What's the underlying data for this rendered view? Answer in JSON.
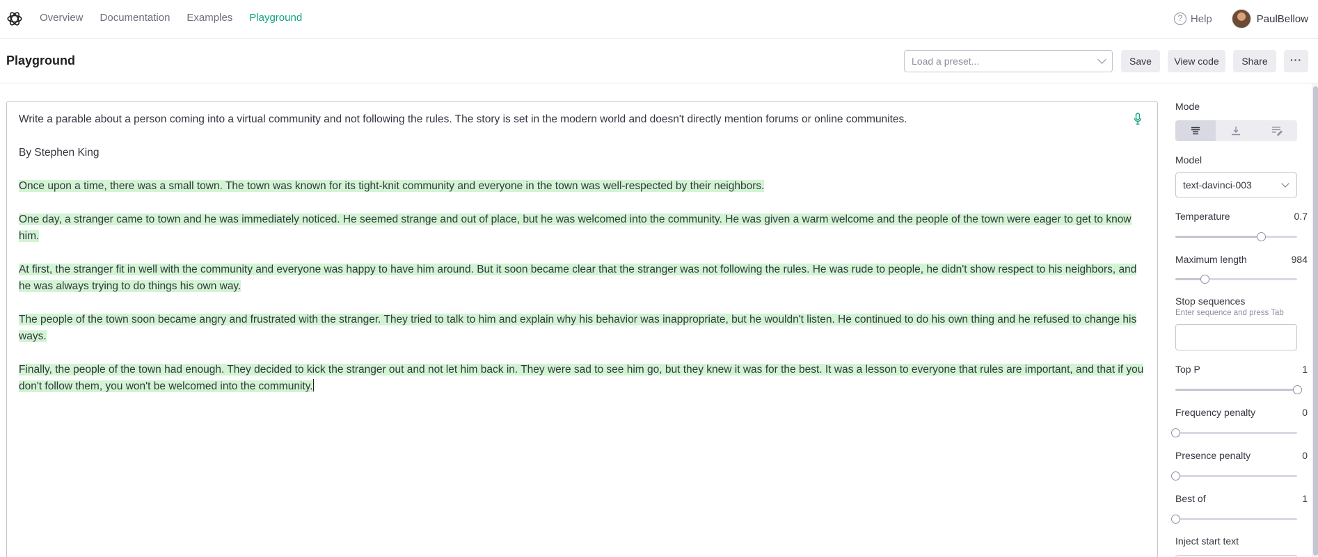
{
  "nav": {
    "links": [
      {
        "label": "Overview"
      },
      {
        "label": "Documentation"
      },
      {
        "label": "Examples"
      },
      {
        "label": "Playground"
      }
    ],
    "active_link": "Playground",
    "help_label": "Help",
    "username": "PaulBellow",
    "accent_color": "#10a37f"
  },
  "header": {
    "title": "Playground",
    "preset_placeholder": "Load a preset...",
    "save_label": "Save",
    "view_code_label": "View code",
    "share_label": "Share",
    "more_label": "···"
  },
  "editor": {
    "prompt": "Write a parable about a person coming into a virtual community and not following the rules. The story is set in the modern world and doesn't directly mention forums or online communites.",
    "byline": "By Stephen King",
    "completion_paragraphs": [
      "Once upon a time, there was a small town. The town was known for its tight-knit community and everyone in the town was well-respected by their neighbors.",
      "One day, a stranger came to town and he was immediately noticed. He seemed strange and out of place, but he was welcomed into the community. He was given a warm welcome and the people of the town were eager  to get to know him.",
      "At first, the stranger fit in well with the community and everyone was happy to have him around. But it soon became clear that the stranger was not following the rules. He was rude to people, he didn't show respect to his neighbors, and he was always trying to do things his own way.",
      "The people of the town soon became angry and frustrated with the stranger. They tried to talk to him and explain why his behavior was inappropriate, but he wouldn't listen. He continued to do his own thing and he refused to change his ways.",
      "Finally, the people of the town had enough. They decided to kick the stranger out and not let him back in. They were sad to see him go, but they knew it was for the best. It was a lesson to everyone that rules are important, and that if you don't follow them, you won't be welcomed into the community."
    ],
    "highlight_color": "#d2f4d3"
  },
  "panel": {
    "mode_label": "Mode",
    "modes": [
      {
        "icon": "complete-mode-icon",
        "active": true
      },
      {
        "icon": "insert-mode-icon",
        "active": false
      },
      {
        "icon": "edit-mode-icon",
        "active": false
      }
    ],
    "model_label": "Model",
    "model_value": "text-davinci-003",
    "temperature": {
      "label": "Temperature",
      "value": "0.7",
      "fraction": 0.7
    },
    "max_length": {
      "label": "Maximum length",
      "value": "984",
      "fraction": 0.24
    },
    "stop_sequences": {
      "label": "Stop sequences",
      "hint": "Enter sequence and press Tab"
    },
    "top_p": {
      "label": "Top P",
      "value": "1",
      "fraction": 1.0
    },
    "frequency_penalty": {
      "label": "Frequency penalty",
      "value": "0",
      "fraction": 0.0
    },
    "presence_penalty": {
      "label": "Presence penalty",
      "value": "0",
      "fraction": 0.0
    },
    "best_of": {
      "label": "Best of",
      "value": "1",
      "fraction": 0.0
    },
    "inject_start_label": "Inject start text"
  }
}
